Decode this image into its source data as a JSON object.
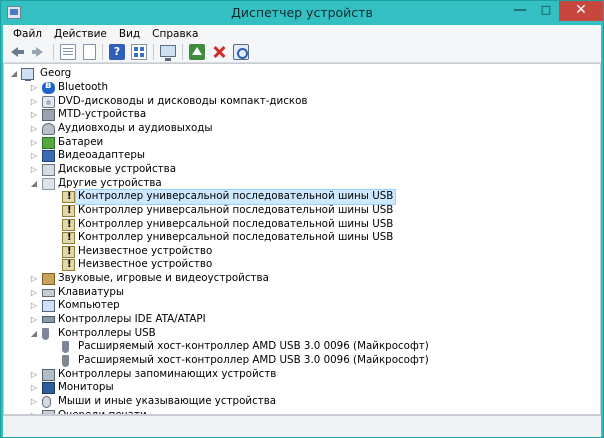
{
  "window": {
    "title": "Диспетчер устройств",
    "controls": {
      "minimize": "—",
      "maximize": "□",
      "close": "✕"
    }
  },
  "menu": [
    {
      "label": "Файл",
      "accel": "Ф"
    },
    {
      "label": "Действие",
      "accel": "Д"
    },
    {
      "label": "Вид",
      "accel": "В"
    },
    {
      "label": "Справка",
      "accel": "С"
    }
  ],
  "toolbar": {
    "buttons": [
      "back-icon",
      "forward-icon",
      "properties-grid-icon",
      "page-icon",
      "help-icon",
      "view-list-icon",
      "monitor-icon",
      "update-driver-icon",
      "uninstall-icon",
      "scan-hardware-icon"
    ]
  },
  "tree": {
    "root": "Georg",
    "items": [
      {
        "label": "Bluetooth",
        "icon": "bluetooth-icon",
        "level": 1,
        "state": "collapsed"
      },
      {
        "label": "DVD-дисководы и дисководы компакт-дисков",
        "icon": "dvd-icon",
        "level": 1,
        "state": "collapsed"
      },
      {
        "label": "MTD-устройства",
        "icon": "mtd-icon",
        "level": 1,
        "state": "collapsed"
      },
      {
        "label": "Аудиовходы и аудиовыходы",
        "icon": "audio-io-icon",
        "level": 1,
        "state": "collapsed"
      },
      {
        "label": "Батареи",
        "icon": "battery-icon",
        "level": 1,
        "state": "collapsed"
      },
      {
        "label": "Видеоадаптеры",
        "icon": "display-adapter-icon",
        "level": 1,
        "state": "collapsed"
      },
      {
        "label": "Дисковые устройства",
        "icon": "disk-drive-icon",
        "level": 1,
        "state": "collapsed"
      },
      {
        "label": "Другие устройства",
        "icon": "other-devices-icon",
        "level": 1,
        "state": "expanded"
      },
      {
        "label": "Контроллер универсальной последовательной шины USB",
        "icon": "warning-device-icon",
        "level": 2,
        "selected": true
      },
      {
        "label": "Контроллер универсальной последовательной шины USB",
        "icon": "warning-device-icon",
        "level": 2
      },
      {
        "label": "Контроллер универсальной последовательной шины USB",
        "icon": "warning-device-icon",
        "level": 2
      },
      {
        "label": "Контроллер универсальной последовательной шины USB",
        "icon": "warning-device-icon",
        "level": 2
      },
      {
        "label": "Неизвестное устройство",
        "icon": "warning-device-icon",
        "level": 2
      },
      {
        "label": "Неизвестное устройство",
        "icon": "warning-device-icon",
        "level": 2
      },
      {
        "label": "Звуковые, игровые и видеоустройства",
        "icon": "sound-icon",
        "level": 1,
        "state": "collapsed"
      },
      {
        "label": "Клавиатуры",
        "icon": "keyboard-icon",
        "level": 1,
        "state": "collapsed"
      },
      {
        "label": "Компьютер",
        "icon": "computer-icon",
        "level": 1,
        "state": "collapsed"
      },
      {
        "label": "Контроллеры IDE ATA/ATAPI",
        "icon": "ide-icon",
        "level": 1,
        "state": "collapsed"
      },
      {
        "label": "Контроллеры USB",
        "icon": "usb-icon",
        "level": 1,
        "state": "expanded"
      },
      {
        "label": "Расширяемый хост-контроллер AMD USB 3.0 0096 (Майкрософт)",
        "icon": "usb-device-icon",
        "level": 2
      },
      {
        "label": "Расширяемый хост-контроллер AMD USB 3.0 0096 (Майкрософт)",
        "icon": "usb-device-icon",
        "level": 2
      },
      {
        "label": "Контроллеры запоминающих устройств",
        "icon": "storage-controller-icon",
        "level": 1,
        "state": "collapsed"
      },
      {
        "label": "Мониторы",
        "icon": "monitor-icon",
        "level": 1,
        "state": "collapsed"
      },
      {
        "label": "Мыши и иные указывающие устройства",
        "icon": "mouse-icon",
        "level": 1,
        "state": "collapsed"
      },
      {
        "label": "Очереди печати",
        "icon": "print-queue-icon",
        "level": 1,
        "state": "collapsed"
      }
    ]
  }
}
